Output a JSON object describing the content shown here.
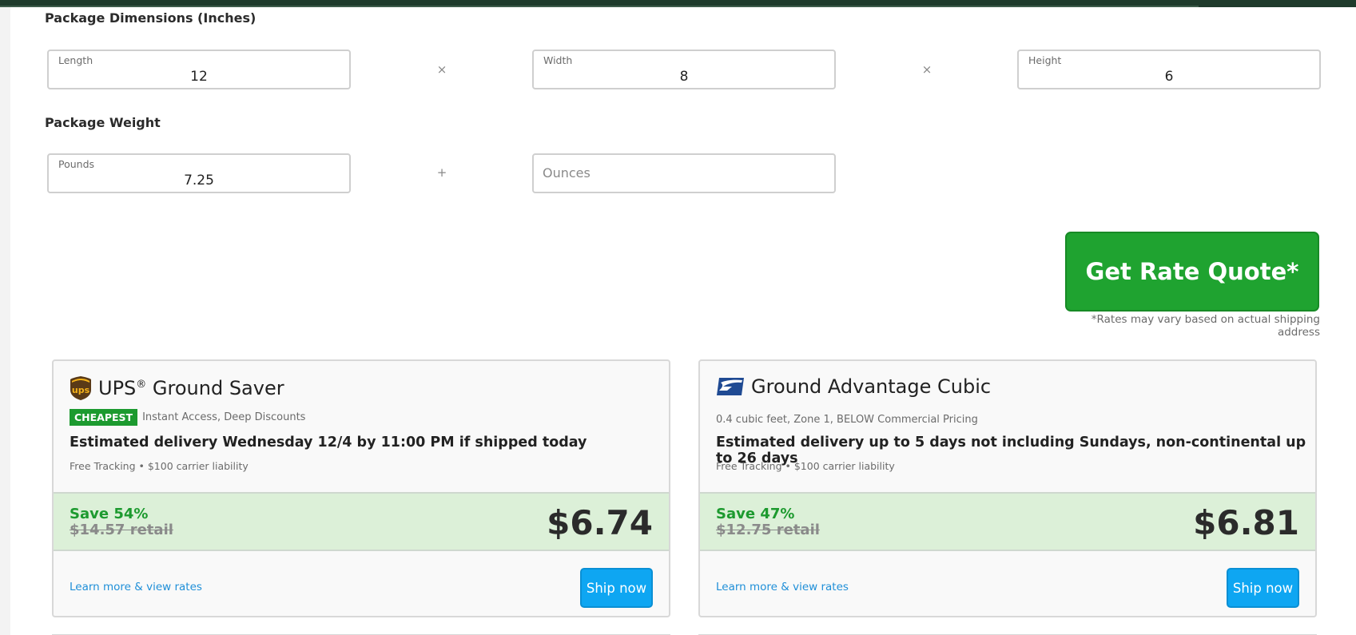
{
  "dimensions": {
    "section_title": "Package Dimensions (Inches)",
    "length": {
      "label": "Length",
      "value": "12"
    },
    "width": {
      "label": "Width",
      "value": "8"
    },
    "height": {
      "label": "Height",
      "value": "6"
    },
    "times_symbol": "×"
  },
  "weight": {
    "section_title": "Package Weight",
    "pounds": {
      "label": "Pounds",
      "value": "7.25"
    },
    "ounces": {
      "placeholder": "Ounces",
      "value": ""
    },
    "plus_symbol": "+"
  },
  "quote": {
    "button_label": "Get Rate Quote*",
    "note": "*Rates may vary based on actual shipping address"
  },
  "cards": [
    {
      "carrier_icon": "ups-logo-icon",
      "title": "UPS",
      "title_mark": "®",
      "title_rest": " Ground Saver",
      "badge": "CHEAPEST",
      "badge_note": "Instant Access, Deep Discounts",
      "delivery": "Estimated delivery Wednesday 12/4 by 11:00 PM if shipped today",
      "features": "Free Tracking • $100 carrier liability",
      "save": "Save 54%",
      "retail": "$14.57 retail",
      "price": "$6.74",
      "learn_link": "Learn more & view rates",
      "ship_label": "Ship now"
    },
    {
      "carrier_icon": "usps-eagle-icon",
      "title": "Ground Advantage Cubic",
      "sub_note": "0.4 cubic feet, Zone 1, BELOW Commercial Pricing",
      "delivery": "Estimated delivery up to 5 days not including Sundays, non-continental up to 26 days",
      "features": "Free Tracking • $100 carrier liability",
      "save": "Save 47%",
      "retail": "$12.75 retail",
      "price": "$6.81",
      "learn_link": "Learn more & view rates",
      "ship_label": "Ship now"
    }
  ],
  "colors": {
    "primary_green": "#1fa330",
    "savings_band": "#dcf0d8",
    "ship_blue": "#0ea6f2",
    "link_blue": "#1f8fd8"
  }
}
